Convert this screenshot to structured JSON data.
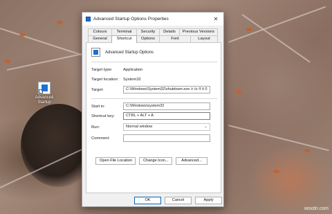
{
  "desktop": {
    "icon_label": "Advanced Startup"
  },
  "dialog": {
    "title": "Advanced Startup Options Properties",
    "close_glyph": "✕",
    "tabs_row1": [
      "Colours",
      "Terminal",
      "Security",
      "Details",
      "Previous Versions"
    ],
    "tabs_row2": [
      "General",
      "Shortcut",
      "Options",
      "Font",
      "Layout"
    ],
    "active_tab": "Shortcut",
    "shortcut_name": "Advanced Startup Options",
    "target_type_label": "Target type:",
    "target_type_value": "Application",
    "target_location_label": "Target location:",
    "target_location_value": "System32",
    "target_label": "Target:",
    "target_value": "C:\\Windows\\System32\\shutdown.exe /r /o /f /t 0",
    "start_in_label": "Start in:",
    "start_in_value": "C:\\Windows\\system32",
    "shortcut_key_label": "Shortcut key:",
    "shortcut_key_value": "CTRL + ALT + A",
    "run_label": "Run:",
    "run_value": "Normal window",
    "comment_label": "Comment:",
    "comment_value": "",
    "buttons": {
      "open_file_location": "Open File Location",
      "change_icon": "Change Icon...",
      "advanced": "Advanced..."
    },
    "footer": {
      "ok": "OK",
      "cancel": "Cancel",
      "apply": "Apply"
    }
  },
  "watermark": "wsxdn.com",
  "colors": {
    "accent": "#0067c0",
    "icon_blue": "#1f6fd1"
  }
}
